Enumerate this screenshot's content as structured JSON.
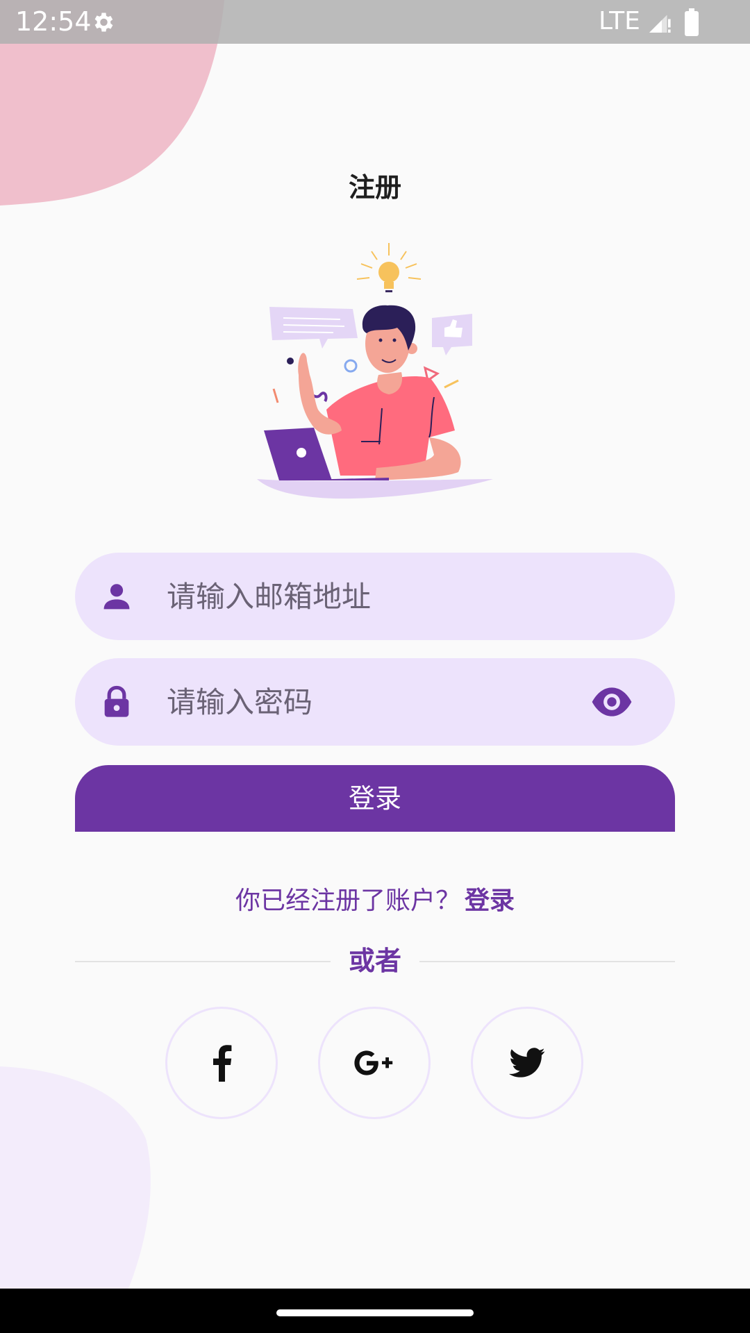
{
  "status_bar": {
    "time": "12:54",
    "network": "LTE",
    "icons": [
      "gear-icon",
      "signal-icon",
      "battery-icon"
    ]
  },
  "page": {
    "title": "注册"
  },
  "form": {
    "email_placeholder": "请输入邮箱地址",
    "email_value": "",
    "password_placeholder": "请输入密码",
    "password_value": "",
    "submit_label": "登录"
  },
  "footer": {
    "already_registered": "你已经注册了账户？",
    "login_link": "登录",
    "or_label": "或者"
  },
  "social": {
    "facebook_icon": "facebook-icon",
    "google_icon": "google-plus-icon",
    "twitter_icon": "twitter-icon"
  },
  "colors": {
    "primary": "#6c35a3",
    "field_bg": "#ede3fc",
    "blob_pink": "#f0bfcc",
    "blob_lavender": "#f3ecfb"
  }
}
